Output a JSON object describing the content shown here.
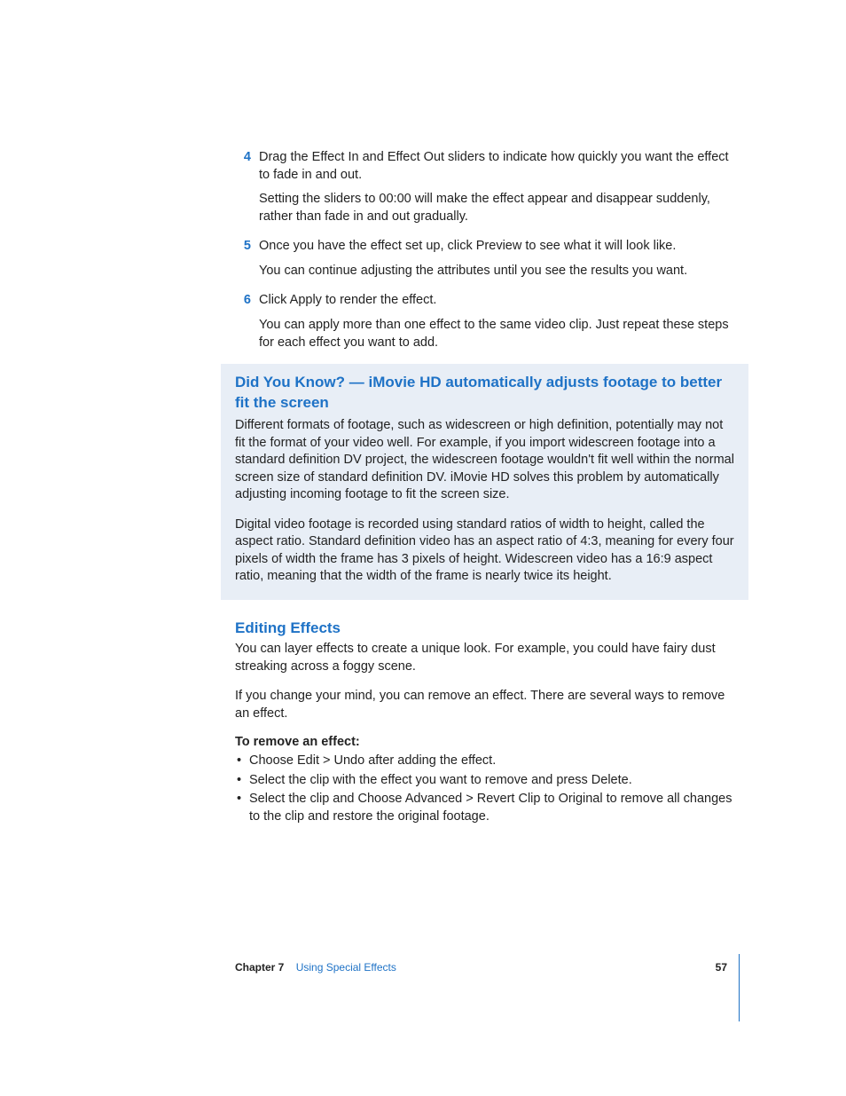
{
  "steps": [
    {
      "num": "4",
      "text": "Drag the Effect In and Effect Out sliders to indicate how quickly you want the effect to fade in and out.",
      "followup": "Setting the sliders to 00:00 will make the effect appear and disappear suddenly, rather than fade in and out gradually."
    },
    {
      "num": "5",
      "text": "Once you have the effect set up, click Preview to see what it will look like.",
      "followup": "You can continue adjusting the attributes until you see the results you want."
    },
    {
      "num": "6",
      "text": "Click Apply to render the effect.",
      "followup": "You can apply more than one effect to the same video clip. Just repeat these steps for each effect you want to add."
    }
  ],
  "callout": {
    "title": "Did You Know? — iMovie HD automatically adjusts footage to better fit the screen",
    "p1": "Different formats of footage, such as widescreen or high definition, potentially may not fit the format of your video well. For example, if you import widescreen footage into a standard definition DV project, the widescreen footage wouldn't fit well within the normal screen size of standard definition DV. iMovie HD solves this problem by automatically adjusting incoming footage to fit the screen size.",
    "p2": "Digital video footage is recorded using standard ratios of width to height, called the aspect ratio. Standard definition video has an aspect ratio of 4:3, meaning for every four pixels of width the frame has 3 pixels of height. Widescreen video has a 16:9 aspect ratio, meaning that the width of the frame is nearly twice its height."
  },
  "section": {
    "title": "Editing Effects",
    "p1": "You can layer effects to create a unique look. For example, you could have fairy dust streaking across a foggy scene.",
    "p2": "If you change your mind, you can remove an effect. There are several ways to remove an effect.",
    "subhead": "To remove an effect:",
    "bullets": [
      "Choose Edit > Undo after adding the effect.",
      "Select the clip with the effect you want to remove and press Delete.",
      "Select the clip and Choose Advanced > Revert Clip to Original to remove all changes to the clip and restore the original footage."
    ]
  },
  "footer": {
    "chapter_label": "Chapter 7",
    "chapter_title": "Using Special Effects",
    "page_number": "57"
  }
}
